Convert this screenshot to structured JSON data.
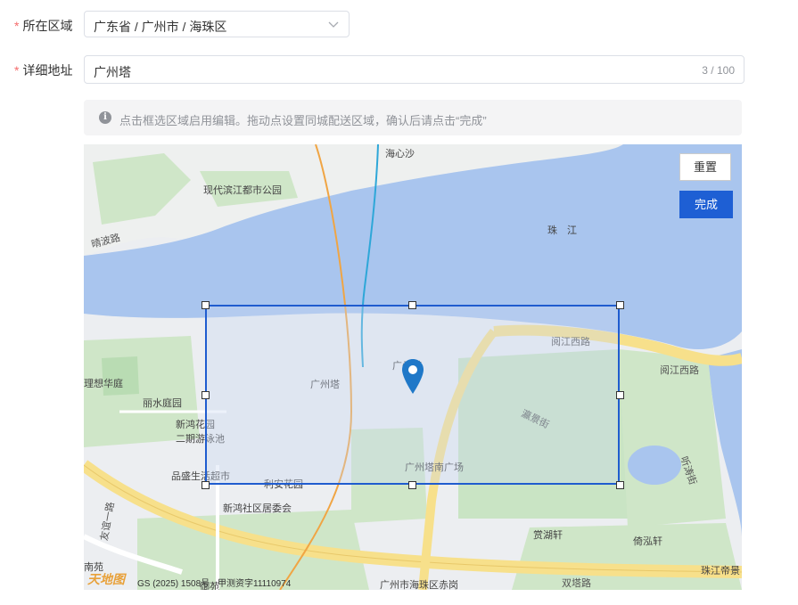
{
  "form": {
    "region_label": "所在区域",
    "region_value": "广东省 / 广州市 / 海珠区",
    "address_label": "详细地址",
    "address_value": "广州塔",
    "address_count": "3 / 100",
    "tip": "点击框选区域启用编辑。拖动点设置同城配送区域，确认后请点击“完成”"
  },
  "map": {
    "reset_label": "重置",
    "done_label": "完成",
    "labels": {
      "haixinsha": "海心沙",
      "park": "现代滨江都市公园",
      "qingbo": "晴波路",
      "zhujiang": "珠　江",
      "yuejiangxi": "阅江西路",
      "yuejiang": "阅江西路",
      "canton_tower": "广州塔",
      "canton_tower_center": "广州塔",
      "lixiang": "理想华庭",
      "lishui": "丽水庭园",
      "xinhong": "新鸿花园",
      "swimming": "二期游泳池",
      "pinsheng": "品盛生活超市",
      "lian": "利安花园",
      "south_square": "广州塔南广场",
      "xinhong_committee": "新鸿社区居委会",
      "youyi": "友谊一路",
      "tingtao": "听涛街",
      "yingjing": "瀛景街",
      "shanghuxuan": "赏湖轩",
      "yihongxuan": "倚泓轩",
      "zhujiang_dijing": "珠江帝景",
      "chigang": "广州市海珠区赤岗",
      "shuangta": "双塔路",
      "nanyuan": "南苑",
      "yuyuan": "御苑"
    },
    "footer_logo": "天地图",
    "footer_copy": "GS (2025) 1508号 · 甲测资字11110974"
  },
  "colors": {
    "water": "#a9c5ee",
    "green": "#c5e3c0",
    "road_major": "#f7e08b",
    "metro": "#2ea7d8",
    "selection": "#1f5ccf",
    "primary_button": "#1e5fd4",
    "pin": "#1f78c8"
  }
}
